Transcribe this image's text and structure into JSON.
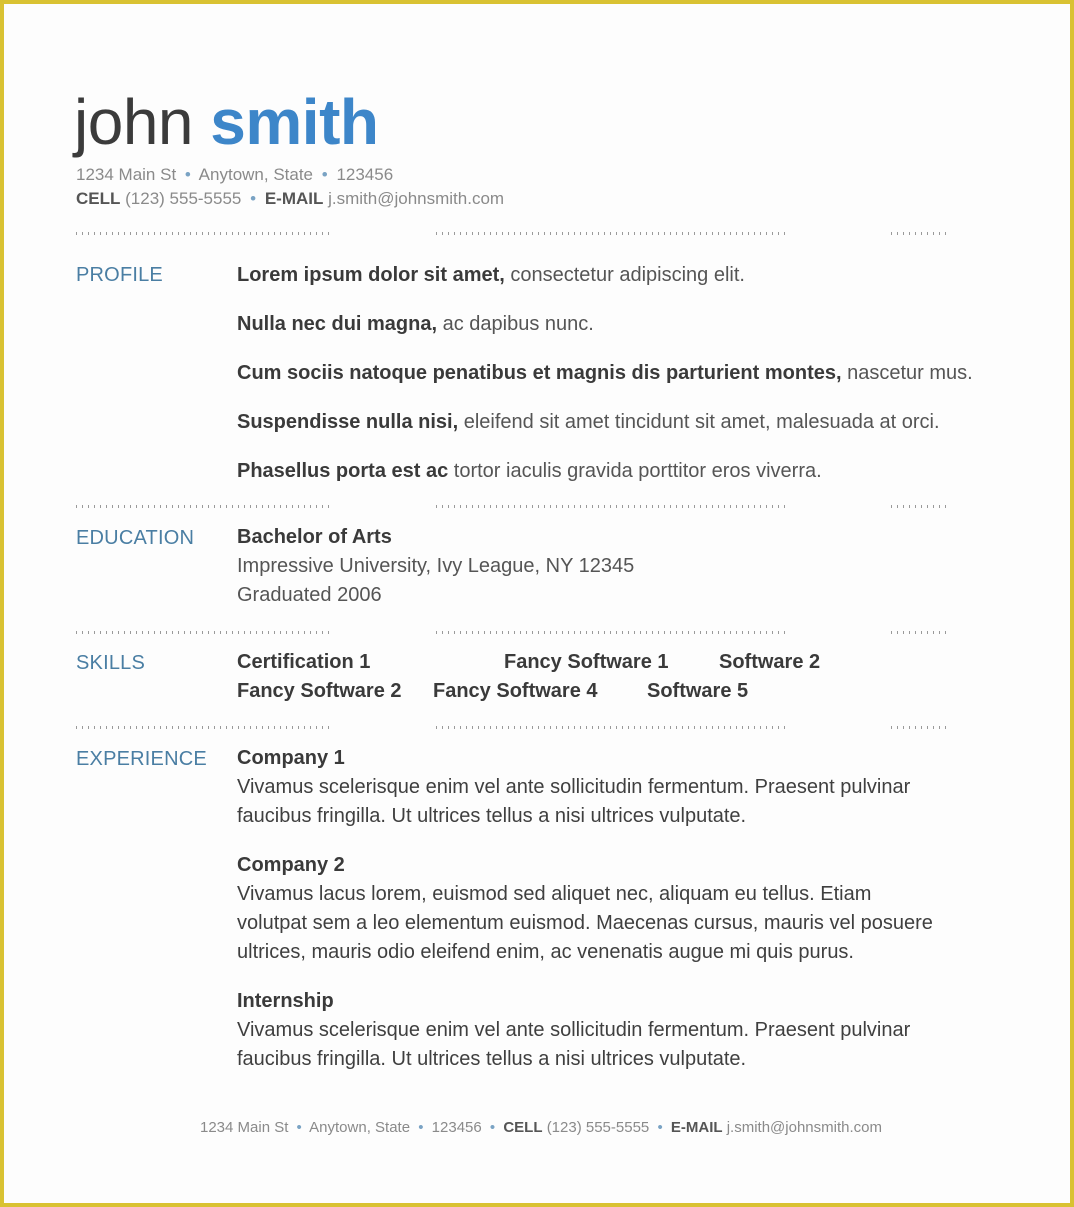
{
  "header": {
    "first_name": "john",
    "last_name": "smith",
    "address": "1234 Main St",
    "city_state": "Anytown, State",
    "zip": "123456",
    "cell_label": "CELL",
    "cell": "(123) 555-5555",
    "email_label": "E-MAIL",
    "email": "j.smith@johnsmith.com",
    "separator": "•"
  },
  "colors": {
    "accent": "#3d86c9",
    "section_label": "#4a7ea3",
    "border": "#d9c232",
    "text": "#404040"
  },
  "sections": {
    "profile": {
      "label": "PROFILE",
      "items": [
        {
          "bold": "Lorem ipsum dolor sit amet,",
          "text": " consectetur adipiscing elit."
        },
        {
          "bold": "Nulla nec dui magna,",
          "text": " ac dapibus nunc."
        },
        {
          "bold": "Cum sociis natoque penatibus et magnis dis parturient montes,",
          "text": " nascetur mus."
        },
        {
          "bold": "Suspendisse nulla nisi,",
          "text": " eleifend sit amet tincidunt sit amet, malesuada at orci."
        },
        {
          "bold": "Phasellus porta est ac",
          "text": " tortor iaculis gravida porttitor eros viverra."
        }
      ]
    },
    "education": {
      "label": "EDUCATION",
      "degree": "Bachelor of Arts",
      "school": "Impressive University, Ivy League, NY 12345",
      "graduated": "Graduated 2006"
    },
    "skills": {
      "label": "SKILLS",
      "items": [
        "Certification 1",
        "Fancy Software 1",
        "Software 2",
        "Fancy Software 2",
        "Fancy Software 4",
        "Software 5"
      ]
    },
    "experience": {
      "label": "EXPERIENCE",
      "items": [
        {
          "company": "Company 1",
          "line1": "Vivamus scelerisque enim vel ante sollicitudin fermentum. Praesent pulvinar",
          "line2": "faucibus fringilla. Ut ultrices tellus a nisi ultrices vulputate.",
          "line3": ""
        },
        {
          "company": "Company 2",
          "line1": "Vivamus lacus lorem, euismod sed aliquet nec, aliquam eu tellus. Etiam",
          "line2": "volutpat sem a leo elementum euismod. Maecenas cursus, mauris vel posuere",
          "line3": "ultrices, mauris odio eleifend enim, ac venenatis augue mi quis purus."
        },
        {
          "company": "Internship",
          "line1": "Vivamus scelerisque enim vel ante sollicitudin fermentum. Praesent pulvinar",
          "line2": "faucibus fringilla. Ut ultrices tellus a nisi ultrices vulputate.",
          "line3": ""
        }
      ]
    }
  }
}
